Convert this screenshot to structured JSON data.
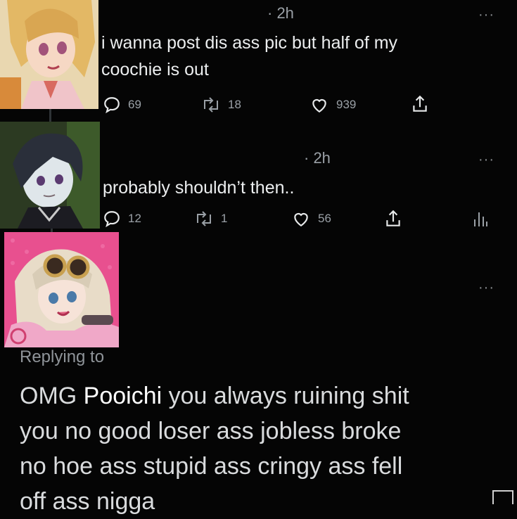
{
  "tweet1": {
    "time": "· 2h",
    "text_line1": "i wanna post dis ass pic but half of my",
    "text_line2": "coochie is out",
    "replies": "69",
    "retweets": "18",
    "likes": "939",
    "more": "···"
  },
  "tweet2": {
    "time": "· 2h",
    "text": "probably shouldn’t then..",
    "replies": "12",
    "retweets": "1",
    "likes": "56",
    "more": "···"
  },
  "reply": {
    "more": "···",
    "replying_to": "Replying to",
    "line1_prefix": "OMG",
    "mention": "Pooichi",
    "line1_suffix": "you always ruining shit",
    "line2": "you no good loser ass jobless broke",
    "line3": "no hoe ass stupid ass cringy ass fell",
    "line4_partial": "off ass nigga"
  },
  "colors": {
    "background": "#050505",
    "text": "#e7e9ea",
    "muted": "#9aa0a6",
    "avatar3_bg": "#e8508f"
  },
  "icons": [
    "reply-icon",
    "retweet-icon",
    "like-icon",
    "share-icon",
    "analytics-icon",
    "more-icon"
  ]
}
